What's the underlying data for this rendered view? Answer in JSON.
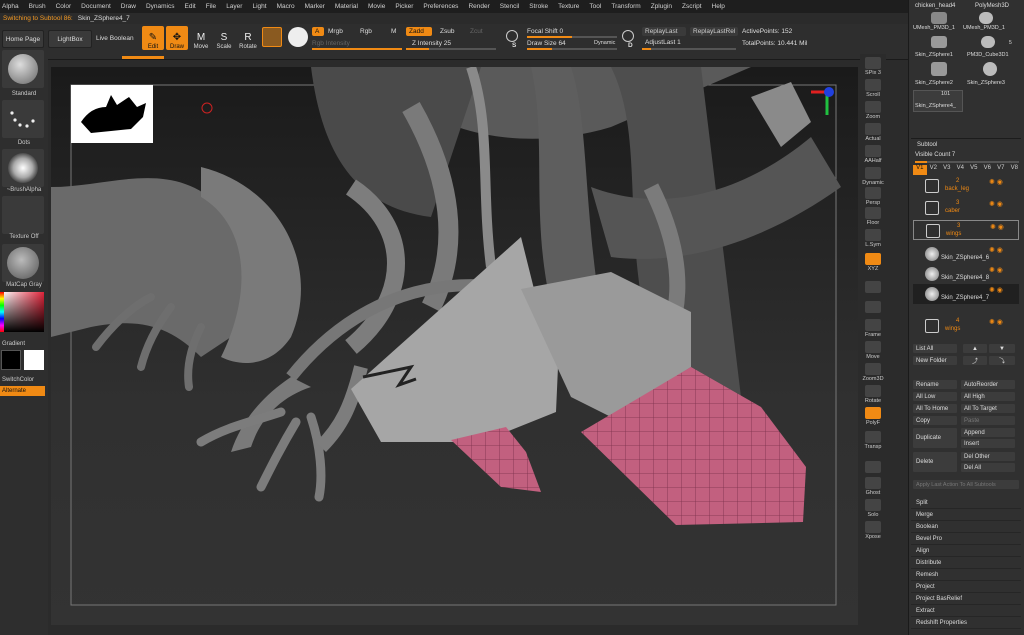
{
  "menu": [
    "Alpha",
    "Brush",
    "Color",
    "Document",
    "Draw",
    "Dynamics",
    "Edit",
    "File",
    "Layer",
    "Light",
    "Macro",
    "Marker",
    "Material",
    "Movie",
    "Picker",
    "Preferences",
    "Render",
    "Stencil",
    "Stroke",
    "Texture",
    "Tool",
    "Transform",
    "Zplugin",
    "Zscript",
    "Help"
  ],
  "status": {
    "message": "Switching to Subtool 86:",
    "subtool": "Skin_ZSphere4_7"
  },
  "shelf": {
    "home": "Home Page",
    "lightbox": "LightBox",
    "live_boolean": "Live Boolean",
    "tools": [
      {
        "label": "Edit",
        "icon": "✎",
        "active": true
      },
      {
        "label": "Draw",
        "icon": "✥",
        "active": true
      },
      {
        "label": "Move",
        "icon": "M",
        "active": false
      },
      {
        "label": "Scale",
        "icon": "S",
        "active": false
      },
      {
        "label": "Rotate",
        "icon": "R",
        "active": false
      }
    ],
    "a": "A",
    "mrgb": "Mrgb",
    "rgb": "Rgb",
    "m": "M",
    "rgb_intensity": "Rgb Intensity",
    "zadd": "Zadd",
    "zsub": "Zsub",
    "zcut": "Zcut",
    "z_intensity_label": "Z Intensity",
    "z_intensity": "25",
    "focal_shift_label": "Focal Shift",
    "focal_shift": "0",
    "draw_size_label": "Draw Size",
    "draw_size": "64",
    "dynamic": "Dynamic",
    "replay_last": "ReplayLast",
    "replay_last_rel": "ReplayLastRel",
    "adjust_last_label": "AdjustLast",
    "adjust_last": "1",
    "active_points_label": "ActivePoints:",
    "active_points": "152",
    "total_points_label": "TotalPoints:",
    "total_points": "10.441 Mil",
    "s_key": "S",
    "d_key": "D"
  },
  "left": {
    "brush": "Standard",
    "stroke": "Dots",
    "alpha": "~BrushAlpha",
    "texture": "Texture Off",
    "material": "MatCap Gray",
    "gradient": "Gradient",
    "switch_color": "SwitchColor",
    "alternate": "Alternate"
  },
  "right_dock": [
    "SPix 3",
    "Scroll",
    "Zoom",
    "Actual",
    "AAHalf",
    "Dynamic",
    "Persp",
    "Floor",
    "L.Sym",
    "XYZ",
    "",
    "",
    "Frame",
    "Move",
    "Zoom3D",
    "Rotate",
    "PolyF",
    "Transp",
    "",
    "Ghost",
    "Solo",
    "Xpose"
  ],
  "panel": {
    "tools": [
      {
        "label": "chicken_head4"
      },
      {
        "label": "PolyMesh3D"
      },
      {
        "label": "UMesh_PM3D_1"
      },
      {
        "label": "UMesh_PM3D_1"
      },
      {
        "label": "PM3D_Cube3D1"
      },
      {
        "label": "Skin_ZSphere1"
      },
      {
        "label": "Skin_ZSphere2"
      },
      {
        "label": "Skin_ZSphere3"
      },
      {
        "label": "Skin_ZSphere4_"
      }
    ],
    "tool_count_a": "101",
    "tool_count_b": "5",
    "subtool_title": "Subtool",
    "visible_count_label": "Visible Count",
    "visible_count": "7",
    "versions": [
      "V1",
      "V2",
      "V3",
      "V4",
      "V5",
      "V6",
      "V7",
      "V8"
    ],
    "subtools": [
      {
        "num": "2",
        "name": "back_leg"
      },
      {
        "num": "3",
        "name": "caber"
      },
      {
        "num": "3",
        "name": "wings"
      },
      {
        "num": "",
        "name": "Skin_ZSphere4_6"
      },
      {
        "num": "",
        "name": "Skin_ZSphere4_8"
      },
      {
        "num": "",
        "name": "Skin_ZSphere4_7"
      },
      {
        "num": "4",
        "name": "wings"
      }
    ],
    "list_all": "List All",
    "new_folder": "New Folder",
    "buttons": [
      [
        "Rename",
        "AutoReorder"
      ],
      [
        "All Low",
        "All High"
      ],
      [
        "All To Home",
        "All To Target"
      ],
      [
        "Copy",
        "Paste"
      ]
    ],
    "duplicate": "Duplicate",
    "append": "Append",
    "insert": "Insert",
    "delete": "Delete",
    "del_other": "Del Other",
    "del_all": "Del All",
    "apply_last": "Apply Last Action To All Subtools",
    "menu": [
      "Split",
      "Merge",
      "Boolean",
      "Bevel Pro",
      "Align",
      "Distribute",
      "Remesh",
      "Project",
      "Project BasRelief",
      "Extract",
      "Redshift Properties"
    ]
  },
  "colors": {
    "accent": "#f08a14",
    "mesh": "#c86a88",
    "clay": "#8a8a8a"
  }
}
